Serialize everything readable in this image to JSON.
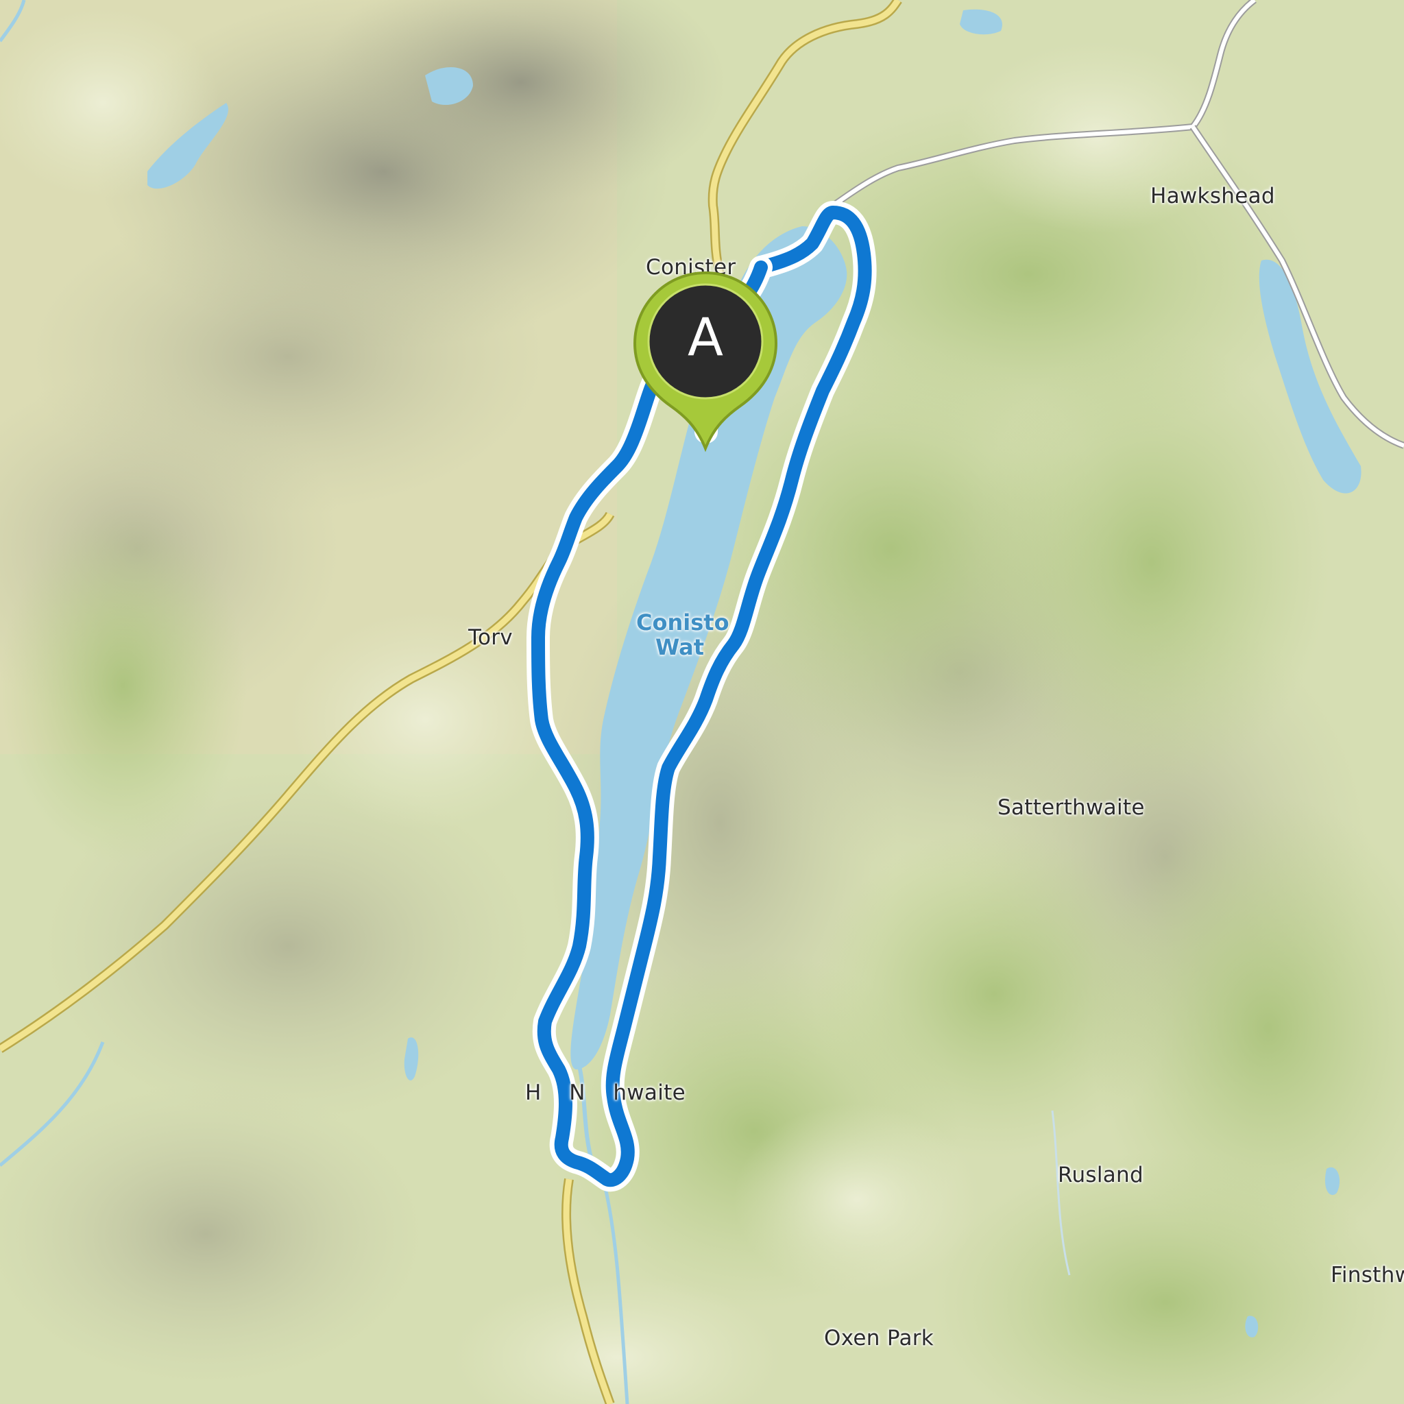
{
  "map": {
    "route_color": "#0f78d2",
    "marker_color": "#a6c93a",
    "marker_inner_color": "#2b2b2b",
    "water_color": "#9fcfe5",
    "road_color": "#f2e48f",
    "minor_road_color": "#ffffff"
  },
  "marker": {
    "label": "A",
    "icon": "map-pin-icon"
  },
  "places": {
    "coniston": "Conister",
    "hawkshead": "Hawkshead",
    "torver": "Torv",
    "satterthwaite": "Satterthwaite",
    "nibthwaite": "H    N    hwaite",
    "rusland": "Rusland",
    "oxen_park": "Oxen Park",
    "finsthwaite": "Finsthw"
  },
  "water": {
    "lake_line1": "Conisto",
    "lake_line2": "Wat"
  }
}
